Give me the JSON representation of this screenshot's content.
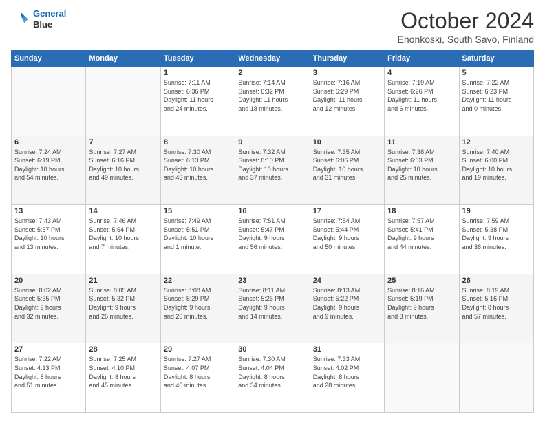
{
  "header": {
    "logo_line1": "General",
    "logo_line2": "Blue",
    "title": "October 2024",
    "subtitle": "Enonkoski, South Savo, Finland"
  },
  "days_of_week": [
    "Sunday",
    "Monday",
    "Tuesday",
    "Wednesday",
    "Thursday",
    "Friday",
    "Saturday"
  ],
  "weeks": [
    [
      {
        "day": "",
        "info": ""
      },
      {
        "day": "",
        "info": ""
      },
      {
        "day": "1",
        "info": "Sunrise: 7:11 AM\nSunset: 6:36 PM\nDaylight: 11 hours\nand 24 minutes."
      },
      {
        "day": "2",
        "info": "Sunrise: 7:14 AM\nSunset: 6:32 PM\nDaylight: 11 hours\nand 18 minutes."
      },
      {
        "day": "3",
        "info": "Sunrise: 7:16 AM\nSunset: 6:29 PM\nDaylight: 11 hours\nand 12 minutes."
      },
      {
        "day": "4",
        "info": "Sunrise: 7:19 AM\nSunset: 6:26 PM\nDaylight: 11 hours\nand 6 minutes."
      },
      {
        "day": "5",
        "info": "Sunrise: 7:22 AM\nSunset: 6:23 PM\nDaylight: 11 hours\nand 0 minutes."
      }
    ],
    [
      {
        "day": "6",
        "info": "Sunrise: 7:24 AM\nSunset: 6:19 PM\nDaylight: 10 hours\nand 54 minutes."
      },
      {
        "day": "7",
        "info": "Sunrise: 7:27 AM\nSunset: 6:16 PM\nDaylight: 10 hours\nand 49 minutes."
      },
      {
        "day": "8",
        "info": "Sunrise: 7:30 AM\nSunset: 6:13 PM\nDaylight: 10 hours\nand 43 minutes."
      },
      {
        "day": "9",
        "info": "Sunrise: 7:32 AM\nSunset: 6:10 PM\nDaylight: 10 hours\nand 37 minutes."
      },
      {
        "day": "10",
        "info": "Sunrise: 7:35 AM\nSunset: 6:06 PM\nDaylight: 10 hours\nand 31 minutes."
      },
      {
        "day": "11",
        "info": "Sunrise: 7:38 AM\nSunset: 6:03 PM\nDaylight: 10 hours\nand 25 minutes."
      },
      {
        "day": "12",
        "info": "Sunrise: 7:40 AM\nSunset: 6:00 PM\nDaylight: 10 hours\nand 19 minutes."
      }
    ],
    [
      {
        "day": "13",
        "info": "Sunrise: 7:43 AM\nSunset: 5:57 PM\nDaylight: 10 hours\nand 13 minutes."
      },
      {
        "day": "14",
        "info": "Sunrise: 7:46 AM\nSunset: 5:54 PM\nDaylight: 10 hours\nand 7 minutes."
      },
      {
        "day": "15",
        "info": "Sunrise: 7:49 AM\nSunset: 5:51 PM\nDaylight: 10 hours\nand 1 minute."
      },
      {
        "day": "16",
        "info": "Sunrise: 7:51 AM\nSunset: 5:47 PM\nDaylight: 9 hours\nand 56 minutes."
      },
      {
        "day": "17",
        "info": "Sunrise: 7:54 AM\nSunset: 5:44 PM\nDaylight: 9 hours\nand 50 minutes."
      },
      {
        "day": "18",
        "info": "Sunrise: 7:57 AM\nSunset: 5:41 PM\nDaylight: 9 hours\nand 44 minutes."
      },
      {
        "day": "19",
        "info": "Sunrise: 7:59 AM\nSunset: 5:38 PM\nDaylight: 9 hours\nand 38 minutes."
      }
    ],
    [
      {
        "day": "20",
        "info": "Sunrise: 8:02 AM\nSunset: 5:35 PM\nDaylight: 9 hours\nand 32 minutes."
      },
      {
        "day": "21",
        "info": "Sunrise: 8:05 AM\nSunset: 5:32 PM\nDaylight: 9 hours\nand 26 minutes."
      },
      {
        "day": "22",
        "info": "Sunrise: 8:08 AM\nSunset: 5:29 PM\nDaylight: 9 hours\nand 20 minutes."
      },
      {
        "day": "23",
        "info": "Sunrise: 8:11 AM\nSunset: 5:26 PM\nDaylight: 9 hours\nand 14 minutes."
      },
      {
        "day": "24",
        "info": "Sunrise: 8:13 AM\nSunset: 5:22 PM\nDaylight: 9 hours\nand 9 minutes."
      },
      {
        "day": "25",
        "info": "Sunrise: 8:16 AM\nSunset: 5:19 PM\nDaylight: 9 hours\nand 3 minutes."
      },
      {
        "day": "26",
        "info": "Sunrise: 8:19 AM\nSunset: 5:16 PM\nDaylight: 8 hours\nand 57 minutes."
      }
    ],
    [
      {
        "day": "27",
        "info": "Sunrise: 7:22 AM\nSunset: 4:13 PM\nDaylight: 8 hours\nand 51 minutes."
      },
      {
        "day": "28",
        "info": "Sunrise: 7:25 AM\nSunset: 4:10 PM\nDaylight: 8 hours\nand 45 minutes."
      },
      {
        "day": "29",
        "info": "Sunrise: 7:27 AM\nSunset: 4:07 PM\nDaylight: 8 hours\nand 40 minutes."
      },
      {
        "day": "30",
        "info": "Sunrise: 7:30 AM\nSunset: 4:04 PM\nDaylight: 8 hours\nand 34 minutes."
      },
      {
        "day": "31",
        "info": "Sunrise: 7:33 AM\nSunset: 4:02 PM\nDaylight: 8 hours\nand 28 minutes."
      },
      {
        "day": "",
        "info": ""
      },
      {
        "day": "",
        "info": ""
      }
    ]
  ]
}
